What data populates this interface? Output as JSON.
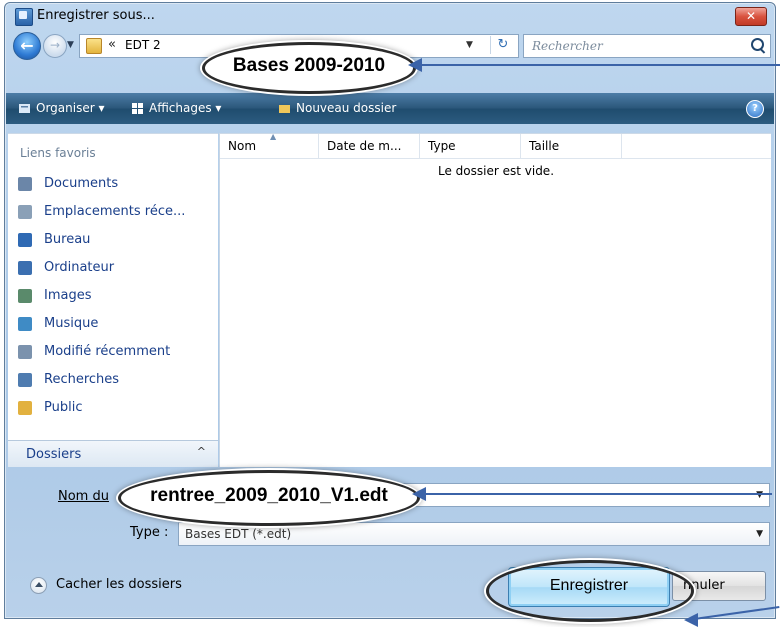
{
  "window": {
    "title": "Enregistrer sous..."
  },
  "address": {
    "chevron": "«",
    "crumb": "EDT 2",
    "callout": "Bases 2009-2010"
  },
  "search": {
    "placeholder": "Rechercher"
  },
  "toolbar": {
    "organise": "Organiser ▾",
    "views": "Affichages ▾",
    "new_folder": "Nouveau dossier"
  },
  "favorites": {
    "header": "Liens favoris",
    "items": [
      {
        "label": "Documents",
        "icon": "documents-icon",
        "color": "#6b86a8"
      },
      {
        "label": "Emplacements réce...",
        "icon": "recent-places-icon",
        "color": "#8aa0b7"
      },
      {
        "label": "Bureau",
        "icon": "desktop-icon",
        "color": "#2f6ab4"
      },
      {
        "label": "Ordinateur",
        "icon": "computer-icon",
        "color": "#3b6fb0"
      },
      {
        "label": "Images",
        "icon": "images-icon",
        "color": "#5a8a6b"
      },
      {
        "label": "Musique",
        "icon": "music-icon",
        "color": "#3f8bc5"
      },
      {
        "label": "Modifié récemment",
        "icon": "recently-modified-icon",
        "color": "#7b92ad"
      },
      {
        "label": "Recherches",
        "icon": "searches-icon",
        "color": "#4f7cb0"
      },
      {
        "label": "Public",
        "icon": "public-folder-icon",
        "color": "#e2b13f"
      }
    ]
  },
  "folders_pane": {
    "label": "Dossiers",
    "toggle": "^"
  },
  "columns": [
    {
      "label": "Nom"
    },
    {
      "label": "Date de m..."
    },
    {
      "label": "Type"
    },
    {
      "label": "Taille"
    }
  ],
  "empty_message": "Le dossier est vide.",
  "filename": {
    "label": "Nom du",
    "value": "rentree_2009_2010_V1.edt"
  },
  "filetype": {
    "label": "Type :",
    "value": "Bases EDT (*.edt)"
  },
  "hide_folders": "Cacher les dossiers",
  "buttons": {
    "save": "Enregistrer",
    "cancel": "Annuler",
    "cancel_partial": "nnuler"
  },
  "colors": {
    "accent": "#3b63a8",
    "link": "#1a3f8a"
  }
}
